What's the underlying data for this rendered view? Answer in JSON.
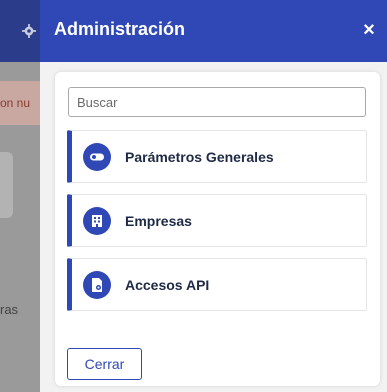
{
  "background": {
    "alert_text": "on nu",
    "side_text": "ras",
    "settings_icon": "gear-icon"
  },
  "drawer": {
    "title": "Administración",
    "close_label": "×",
    "search": {
      "placeholder": "Buscar",
      "value": ""
    },
    "items": [
      {
        "label": "Parámetros Generales",
        "icon": "toggle-icon"
      },
      {
        "label": "Empresas",
        "icon": "building-icon"
      },
      {
        "label": "Accesos API",
        "icon": "api-key-icon"
      }
    ],
    "close_button_label": "Cerrar"
  },
  "colors": {
    "accent": "#2f48b6",
    "overlay": "#9a9a9a"
  }
}
